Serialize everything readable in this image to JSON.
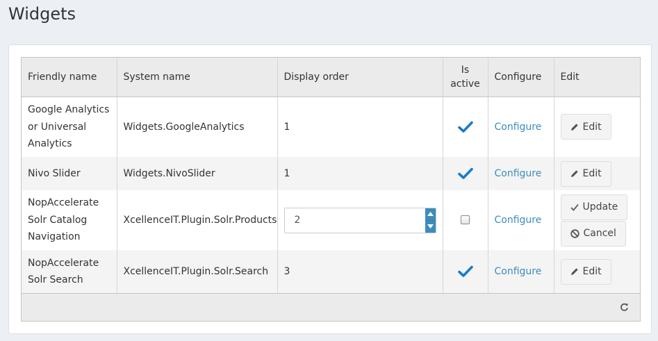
{
  "page": {
    "title": "Widgets"
  },
  "columns": {
    "friendly": "Friendly name",
    "system": "System name",
    "order": "Display order",
    "active_line1": "Is",
    "active_line2": "active",
    "configure": "Configure",
    "edit": "Edit"
  },
  "rows": [
    {
      "friendly": "Google Analytics or Universal Analytics",
      "system": "Widgets.GoogleAnalytics",
      "order": "1",
      "active": true,
      "configure": "Configure",
      "edit": "Edit"
    },
    {
      "friendly": "Nivo Slider",
      "system": "Widgets.NivoSlider",
      "order": "1",
      "active": true,
      "configure": "Configure",
      "edit": "Edit"
    },
    {
      "friendly": "NopAccelerate Solr Catalog Navigation",
      "system": "XcellenceIT.Plugin.Solr.Products",
      "order": "2",
      "active": false,
      "configure": "Configure",
      "update": "Update",
      "cancel": "Cancel"
    },
    {
      "friendly": "NopAccelerate Solr Search",
      "system": "XcellenceIT.Plugin.Solr.Search",
      "order": "3",
      "active": true,
      "configure": "Configure",
      "edit": "Edit"
    }
  ],
  "colors": {
    "accent": "#3c8dbc",
    "check": "#1a7bc8"
  },
  "icons": {
    "edit": "pencil-icon",
    "update": "checkmark-icon",
    "cancel": "cancel-icon",
    "active": "checkmark-icon",
    "refresh": "refresh-icon"
  }
}
